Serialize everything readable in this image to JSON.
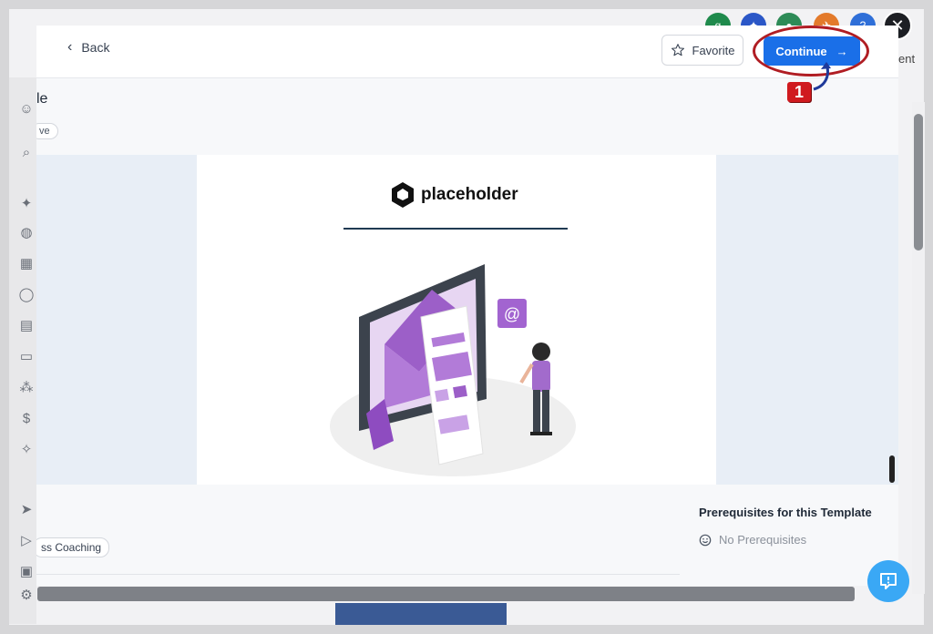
{
  "header": {
    "back_label": "Back",
    "favorite_label": "Favorite",
    "continue_label": "Continue",
    "step_number": "1"
  },
  "page": {
    "title_fragment": "le",
    "status_tag_fragment": "ve"
  },
  "preview": {
    "brand_name": "placeholder"
  },
  "details": {
    "category_tag_fragment": "ss Coaching",
    "prerequisites_title": "Prerequisites for this Template",
    "prerequisites_value": "No Prerequisites"
  },
  "background": {
    "partial_text": "ent",
    "avatars": [
      {
        "initial": "g",
        "color": "#1f8a4c"
      },
      {
        "initial": "✦",
        "color": "#2b57c7"
      },
      {
        "initial": "●",
        "color": "#2e8b57"
      },
      {
        "initial": "✈",
        "color": "#e37a2b"
      },
      {
        "initial": "?",
        "color": "#2f6fd8"
      }
    ]
  },
  "colors": {
    "primary": "#1a6fe8",
    "highlight": "#b01d23",
    "chat": "#3aa8f5"
  }
}
